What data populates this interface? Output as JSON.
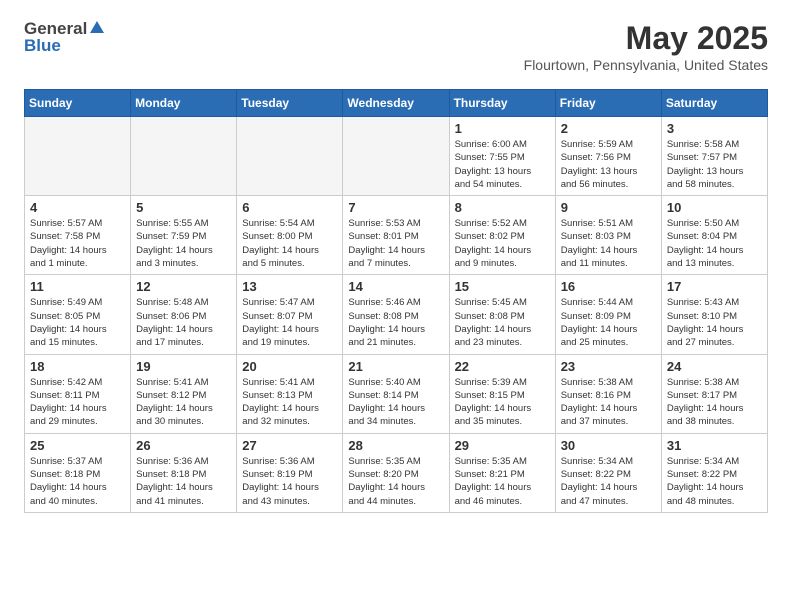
{
  "logo": {
    "general": "General",
    "blue": "Blue"
  },
  "title": {
    "month_year": "May 2025",
    "location": "Flourtown, Pennsylvania, United States"
  },
  "weekdays": [
    "Sunday",
    "Monday",
    "Tuesday",
    "Wednesday",
    "Thursday",
    "Friday",
    "Saturday"
  ],
  "weeks": [
    [
      {
        "day": "",
        "info": ""
      },
      {
        "day": "",
        "info": ""
      },
      {
        "day": "",
        "info": ""
      },
      {
        "day": "",
        "info": ""
      },
      {
        "day": "1",
        "info": "Sunrise: 6:00 AM\nSunset: 7:55 PM\nDaylight: 13 hours\nand 54 minutes."
      },
      {
        "day": "2",
        "info": "Sunrise: 5:59 AM\nSunset: 7:56 PM\nDaylight: 13 hours\nand 56 minutes."
      },
      {
        "day": "3",
        "info": "Sunrise: 5:58 AM\nSunset: 7:57 PM\nDaylight: 13 hours\nand 58 minutes."
      }
    ],
    [
      {
        "day": "4",
        "info": "Sunrise: 5:57 AM\nSunset: 7:58 PM\nDaylight: 14 hours\nand 1 minute."
      },
      {
        "day": "5",
        "info": "Sunrise: 5:55 AM\nSunset: 7:59 PM\nDaylight: 14 hours\nand 3 minutes."
      },
      {
        "day": "6",
        "info": "Sunrise: 5:54 AM\nSunset: 8:00 PM\nDaylight: 14 hours\nand 5 minutes."
      },
      {
        "day": "7",
        "info": "Sunrise: 5:53 AM\nSunset: 8:01 PM\nDaylight: 14 hours\nand 7 minutes."
      },
      {
        "day": "8",
        "info": "Sunrise: 5:52 AM\nSunset: 8:02 PM\nDaylight: 14 hours\nand 9 minutes."
      },
      {
        "day": "9",
        "info": "Sunrise: 5:51 AM\nSunset: 8:03 PM\nDaylight: 14 hours\nand 11 minutes."
      },
      {
        "day": "10",
        "info": "Sunrise: 5:50 AM\nSunset: 8:04 PM\nDaylight: 14 hours\nand 13 minutes."
      }
    ],
    [
      {
        "day": "11",
        "info": "Sunrise: 5:49 AM\nSunset: 8:05 PM\nDaylight: 14 hours\nand 15 minutes."
      },
      {
        "day": "12",
        "info": "Sunrise: 5:48 AM\nSunset: 8:06 PM\nDaylight: 14 hours\nand 17 minutes."
      },
      {
        "day": "13",
        "info": "Sunrise: 5:47 AM\nSunset: 8:07 PM\nDaylight: 14 hours\nand 19 minutes."
      },
      {
        "day": "14",
        "info": "Sunrise: 5:46 AM\nSunset: 8:08 PM\nDaylight: 14 hours\nand 21 minutes."
      },
      {
        "day": "15",
        "info": "Sunrise: 5:45 AM\nSunset: 8:08 PM\nDaylight: 14 hours\nand 23 minutes."
      },
      {
        "day": "16",
        "info": "Sunrise: 5:44 AM\nSunset: 8:09 PM\nDaylight: 14 hours\nand 25 minutes."
      },
      {
        "day": "17",
        "info": "Sunrise: 5:43 AM\nSunset: 8:10 PM\nDaylight: 14 hours\nand 27 minutes."
      }
    ],
    [
      {
        "day": "18",
        "info": "Sunrise: 5:42 AM\nSunset: 8:11 PM\nDaylight: 14 hours\nand 29 minutes."
      },
      {
        "day": "19",
        "info": "Sunrise: 5:41 AM\nSunset: 8:12 PM\nDaylight: 14 hours\nand 30 minutes."
      },
      {
        "day": "20",
        "info": "Sunrise: 5:41 AM\nSunset: 8:13 PM\nDaylight: 14 hours\nand 32 minutes."
      },
      {
        "day": "21",
        "info": "Sunrise: 5:40 AM\nSunset: 8:14 PM\nDaylight: 14 hours\nand 34 minutes."
      },
      {
        "day": "22",
        "info": "Sunrise: 5:39 AM\nSunset: 8:15 PM\nDaylight: 14 hours\nand 35 minutes."
      },
      {
        "day": "23",
        "info": "Sunrise: 5:38 AM\nSunset: 8:16 PM\nDaylight: 14 hours\nand 37 minutes."
      },
      {
        "day": "24",
        "info": "Sunrise: 5:38 AM\nSunset: 8:17 PM\nDaylight: 14 hours\nand 38 minutes."
      }
    ],
    [
      {
        "day": "25",
        "info": "Sunrise: 5:37 AM\nSunset: 8:18 PM\nDaylight: 14 hours\nand 40 minutes."
      },
      {
        "day": "26",
        "info": "Sunrise: 5:36 AM\nSunset: 8:18 PM\nDaylight: 14 hours\nand 41 minutes."
      },
      {
        "day": "27",
        "info": "Sunrise: 5:36 AM\nSunset: 8:19 PM\nDaylight: 14 hours\nand 43 minutes."
      },
      {
        "day": "28",
        "info": "Sunrise: 5:35 AM\nSunset: 8:20 PM\nDaylight: 14 hours\nand 44 minutes."
      },
      {
        "day": "29",
        "info": "Sunrise: 5:35 AM\nSunset: 8:21 PM\nDaylight: 14 hours\nand 46 minutes."
      },
      {
        "day": "30",
        "info": "Sunrise: 5:34 AM\nSunset: 8:22 PM\nDaylight: 14 hours\nand 47 minutes."
      },
      {
        "day": "31",
        "info": "Sunrise: 5:34 AM\nSunset: 8:22 PM\nDaylight: 14 hours\nand 48 minutes."
      }
    ]
  ]
}
